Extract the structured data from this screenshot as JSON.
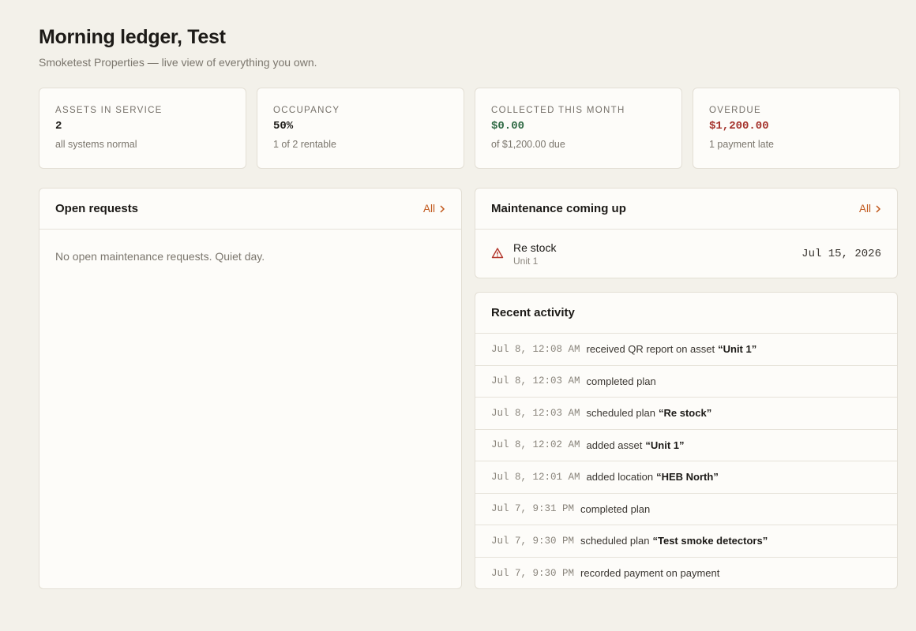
{
  "header": {
    "title": "Morning ledger, Test",
    "subtitle": "Smoketest Properties — live view of everything you own."
  },
  "stats": [
    {
      "label": "ASSETS IN SERVICE",
      "value": "2",
      "note": "all systems normal",
      "tone": "default"
    },
    {
      "label": "OCCUPANCY",
      "value": "50%",
      "note": "1 of 2 rentable",
      "tone": "default"
    },
    {
      "label": "COLLECTED THIS MONTH",
      "value": "$0.00",
      "note": "of $1,200.00 due",
      "tone": "green"
    },
    {
      "label": "OVERDUE",
      "value": "$1,200.00",
      "note": "1 payment late",
      "tone": "red"
    }
  ],
  "colors": {
    "accent": "#c1571b",
    "positive": "#2f6a44",
    "negative": "#a4312a",
    "background": "#f3f1ea"
  },
  "open_requests": {
    "title": "Open requests",
    "all_label": "All",
    "empty_text": "No open maintenance requests. Quiet day."
  },
  "maintenance": {
    "title": "Maintenance coming up",
    "all_label": "All",
    "items": [
      {
        "name": "Re stock",
        "location": "Unit 1",
        "date": "Jul 15, 2026",
        "icon": "warning-triangle-icon"
      }
    ]
  },
  "activity": {
    "title": "Recent activity",
    "items": [
      {
        "time": "Jul 8, 12:08 AM",
        "text": "received QR report on asset",
        "object": "“Unit 1”"
      },
      {
        "time": "Jul 8, 12:03 AM",
        "text": "completed plan",
        "object": ""
      },
      {
        "time": "Jul 8, 12:03 AM",
        "text": "scheduled plan",
        "object": "“Re stock”"
      },
      {
        "time": "Jul 8, 12:02 AM",
        "text": "added asset",
        "object": "“Unit 1”"
      },
      {
        "time": "Jul 8, 12:01 AM",
        "text": "added location",
        "object": "“HEB North”"
      },
      {
        "time": "Jul 7, 9:31 PM",
        "text": "completed plan",
        "object": ""
      },
      {
        "time": "Jul 7, 9:30 PM",
        "text": "scheduled plan",
        "object": "“Test smoke detectors”"
      },
      {
        "time": "Jul 7, 9:30 PM",
        "text": "recorded payment on payment",
        "object": ""
      }
    ]
  }
}
